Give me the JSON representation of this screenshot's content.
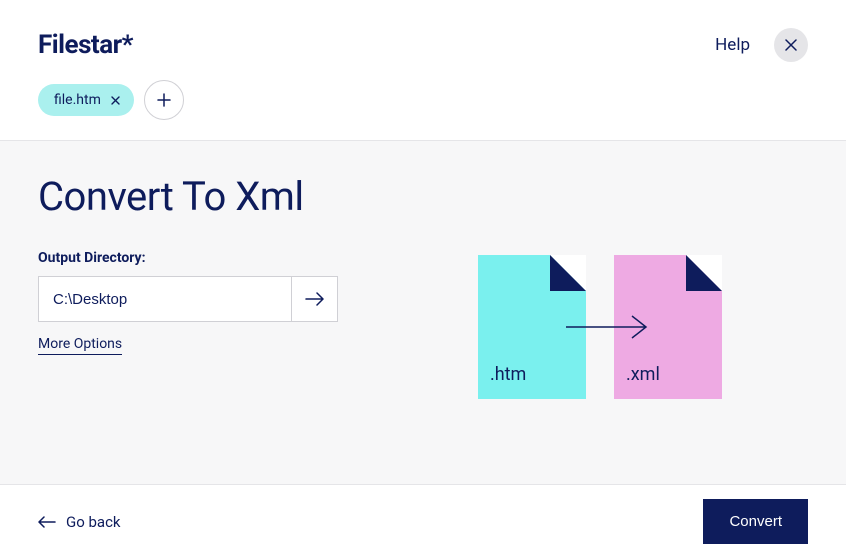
{
  "brand": "Filestar*",
  "header": {
    "help_label": "Help"
  },
  "files": {
    "chip_label": "file.htm"
  },
  "page": {
    "title": "Convert To Xml"
  },
  "output": {
    "label": "Output Directory:",
    "value": "C:\\Desktop"
  },
  "more_options_label": "More Options",
  "illustration": {
    "src_ext": ".htm",
    "dst_ext": ".xml"
  },
  "footer": {
    "go_back_label": "Go back",
    "convert_label": "Convert"
  }
}
